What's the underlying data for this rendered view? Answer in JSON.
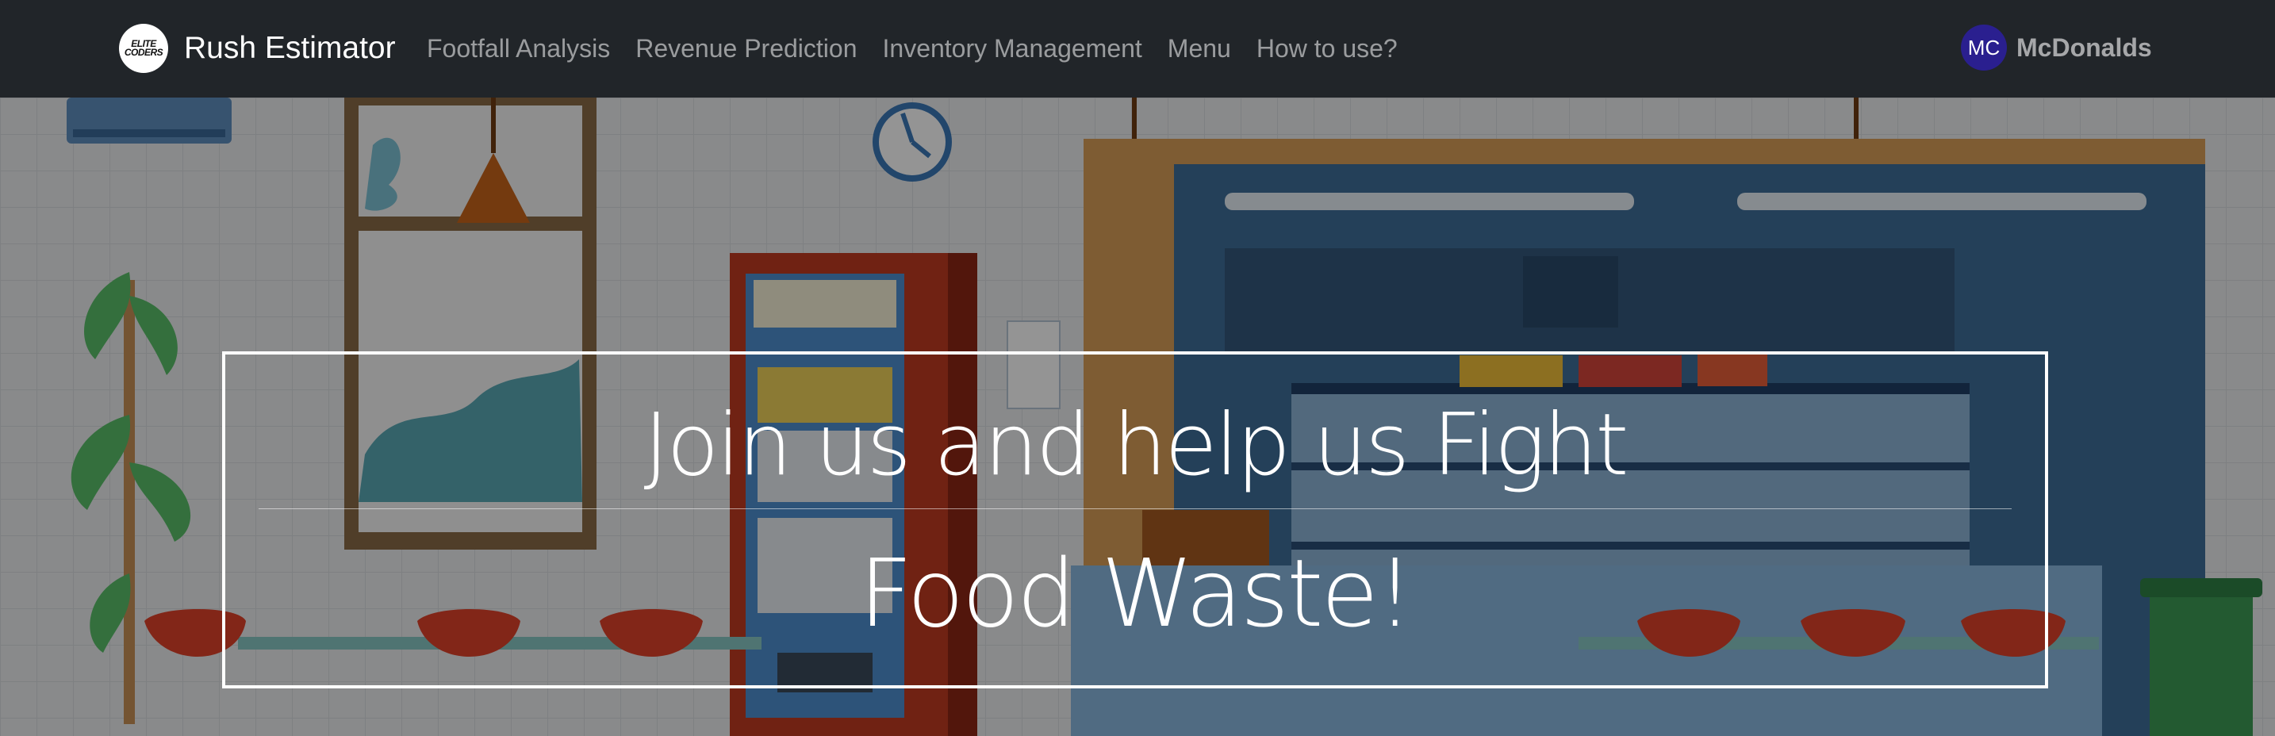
{
  "navbar": {
    "brand_logo_text": "ELITE CODERS",
    "brand_name": "Rush Estimator",
    "links": [
      {
        "label": "Footfall Analysis"
      },
      {
        "label": "Revenue Prediction"
      },
      {
        "label": "Inventory Management"
      },
      {
        "label": "Menu"
      },
      {
        "label": "How to use?"
      }
    ],
    "user": {
      "initials": "MC",
      "name": "McDonalds",
      "avatar_color": "#2a1f8f"
    }
  },
  "hero": {
    "line1": "Join us and help us Fight",
    "line2": "Food Waste!",
    "background": "cafeteria-illustration"
  },
  "colors": {
    "navbar_bg": "#212529",
    "nav_link": "rgba(255,255,255,0.55)"
  }
}
